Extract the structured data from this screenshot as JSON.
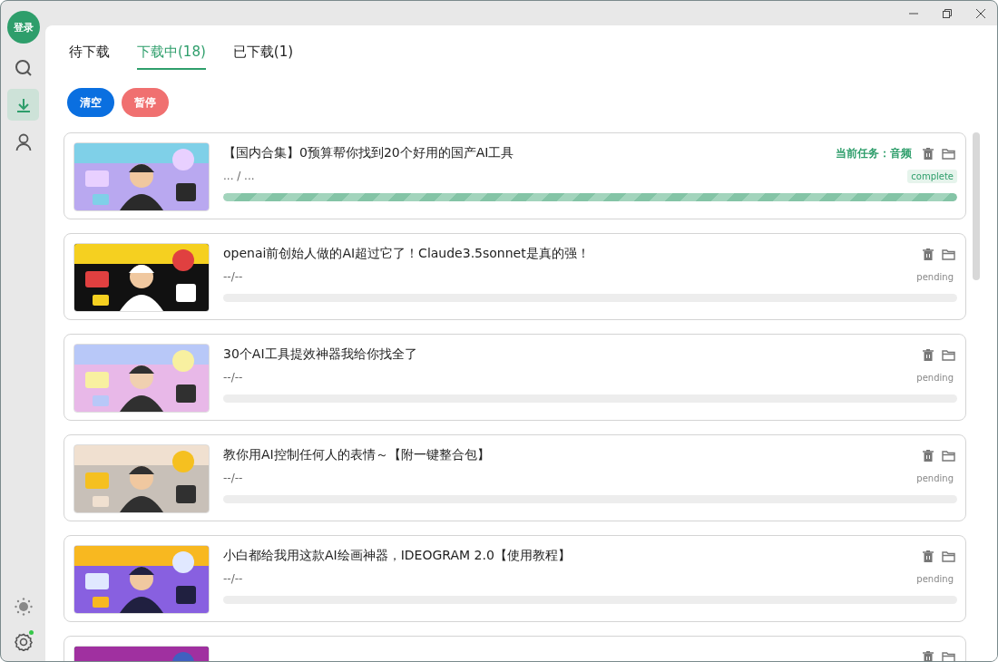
{
  "sidebar": {
    "login": "登录",
    "nav": [
      {
        "kind": "search",
        "selected": false
      },
      {
        "kind": "download",
        "selected": true
      },
      {
        "kind": "user",
        "selected": false
      }
    ],
    "bottom": [
      {
        "kind": "theme"
      },
      {
        "kind": "settings",
        "badge": true
      }
    ]
  },
  "tabs": [
    {
      "label": "待下载",
      "selected": false
    },
    {
      "label": "下载中(18)",
      "selected": true
    },
    {
      "label": "已下载(1)",
      "selected": false
    }
  ],
  "actions": [
    {
      "label": "清空",
      "kind": "primary"
    },
    {
      "label": "暂停",
      "kind": "danger"
    }
  ],
  "tasks": [
    {
      "thumbnail": {
        "kind": "picture"
      },
      "title": "【国内合集】0预算帮你找到20个好用的国产AI工具",
      "current_task": "当前任务：音频",
      "progress_text": "... / ...",
      "status": "complete",
      "level": 1
    },
    {
      "thumbnail": {
        "kind": "picture"
      },
      "title": "openai前创始人做的AI超过它了！Claude3.5sonnet是真的强！",
      "progress_text": "--/--",
      "status": "pending",
      "level": 0
    },
    {
      "thumbnail": {
        "kind": "picture"
      },
      "title": "30个AI工具提效神器我给你找全了",
      "progress_text": "--/--",
      "status": "pending",
      "level": 0
    },
    {
      "thumbnail": {
        "kind": "picture"
      },
      "title": "教你用AI控制任何人的表情～【附一键整合包】",
      "progress_text": "--/--",
      "status": "pending",
      "level": 0
    },
    {
      "thumbnail": {
        "kind": "picture"
      },
      "title": "小白都给我用这款AI绘画神器，IDEOGRAM 2.0【使用教程】",
      "progress_text": "--/--",
      "status": "pending",
      "level": 0
    },
    {
      "thumbnail": {
        "kind": "picture"
      }
    }
  ]
}
